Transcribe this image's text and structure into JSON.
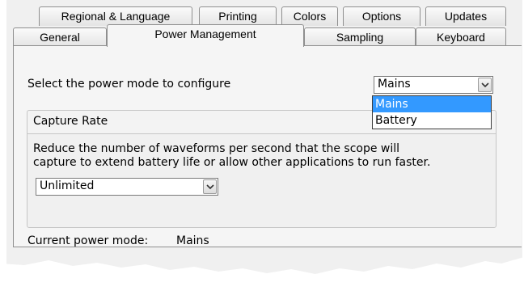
{
  "tabs_row1": [
    {
      "label": "Regional & Language"
    },
    {
      "label": "Printing"
    },
    {
      "label": "Colors"
    },
    {
      "label": "Options"
    },
    {
      "label": "Updates"
    }
  ],
  "tabs_row2": [
    {
      "label": "General"
    },
    {
      "label": "Power Management",
      "active": true
    },
    {
      "label": "Sampling"
    },
    {
      "label": "Keyboard"
    }
  ],
  "power_mode": {
    "prompt": "Select the power mode to configure",
    "selected": "Mains",
    "options": [
      "Mains",
      "Battery"
    ],
    "highlighted": "Mains"
  },
  "capture_rate": {
    "title": "Capture Rate",
    "description_line1": "Reduce the number of waveforms per second that the scope will",
    "description_line2": "capture to extend battery life or allow other applications to run faster.",
    "selected": "Unlimited"
  },
  "current_mode": {
    "label": "Current power mode:",
    "value": "Mains"
  },
  "colors": {
    "selection": "#3399ff",
    "dialog_bg": "#f0f0f0"
  },
  "icons": [
    "chevron-down-icon"
  ]
}
